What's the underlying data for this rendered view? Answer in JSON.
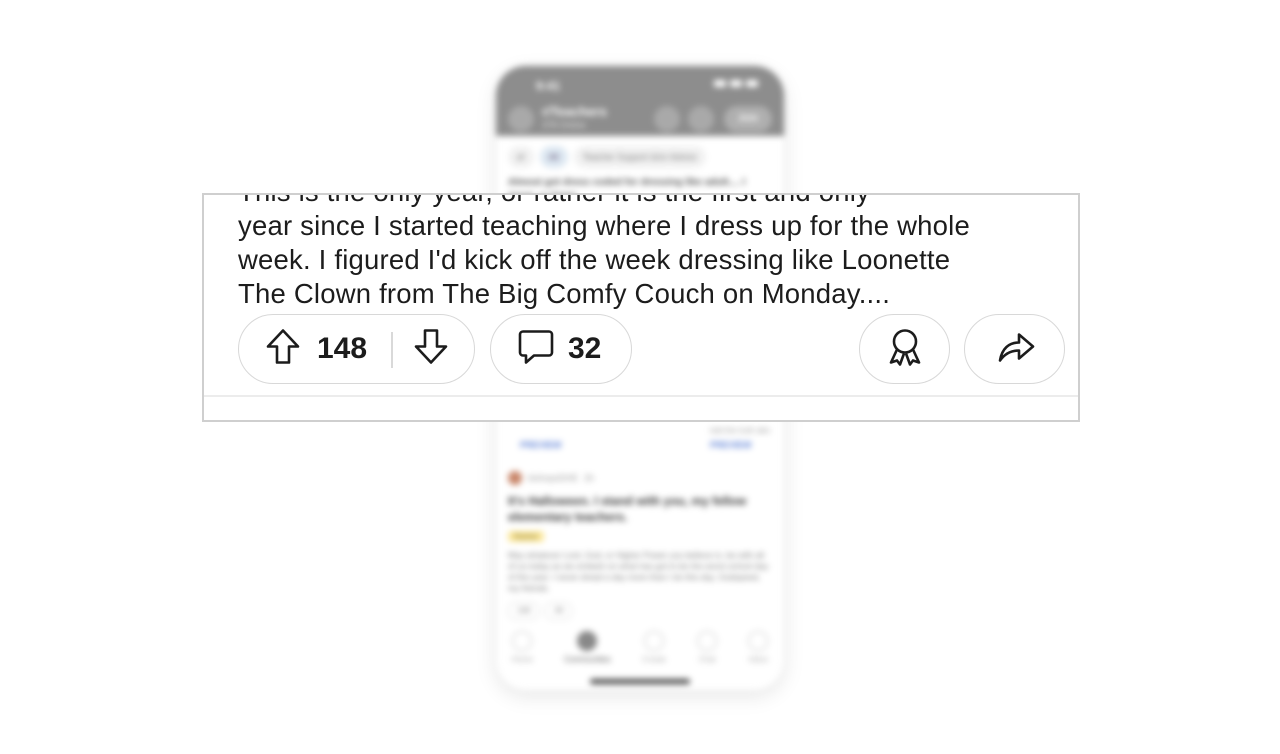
{
  "background_phone": {
    "status_time": "9:41",
    "subreddit_name": "r/Teachers",
    "online_text": "378 Online",
    "join_label": "Join",
    "filters": [
      "All",
      "Teacher Support &/or Advice"
    ],
    "feed_preview_text": "Almost got dress coded for dressing like adult.... I mean, a clown",
    "preview_labels": [
      "PREVIEW",
      "PREVIEW"
    ],
    "preview_snippet": "told the truth abo",
    "post2": {
      "author": "bishopsDHE",
      "age": "2h",
      "title": "It's Halloween. I stand with you, my fellow elementary teachers.",
      "flair": "Humor",
      "body": "May whatever Lord, God, or Higher Power you believe in, be with all of us today as we embark on what has got to be the worst school day of the year. I never dread a day more than I do this day. Godspeed, my friends.",
      "upvotes": "168",
      "comments": "49"
    },
    "tabs": [
      "Home",
      "Communities",
      "Create",
      "Chat",
      "Inbox"
    ],
    "active_tab": "Communities"
  },
  "zoom": {
    "post_lines": [
      "This is the only year, or rather it is the first and only",
      "year since I started teaching where I dress up for the whole",
      "week. I figured I'd kick off the week dressing like Loonette",
      "The Clown from The Big Comfy Couch on Monday...."
    ],
    "upvote_count": "148",
    "comment_count": "32",
    "icons": {
      "upvote": "arrow-up-icon",
      "downvote": "arrow-down-icon",
      "comment": "comment-bubble-icon",
      "award": "award-icon",
      "share": "share-icon"
    }
  }
}
